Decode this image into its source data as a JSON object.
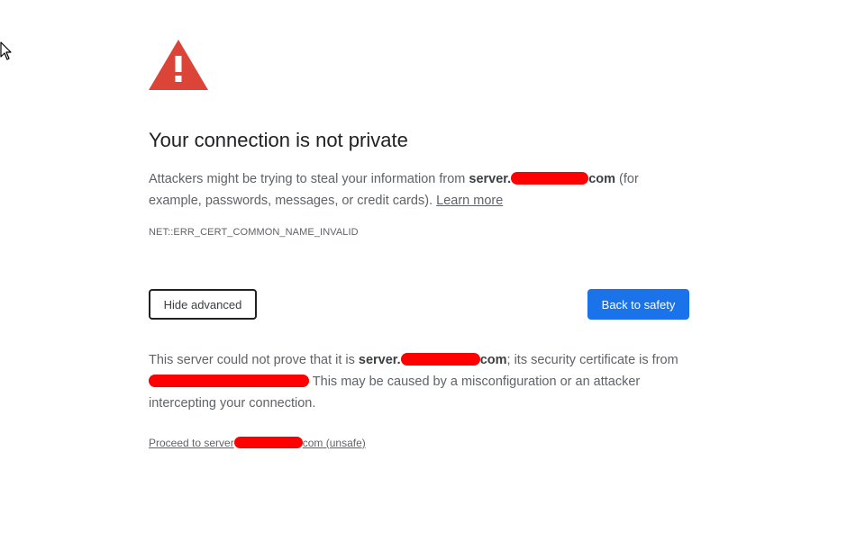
{
  "interstitial": {
    "title": "Your connection is not private",
    "intro": {
      "text_before": "Attackers might be trying to steal your information from ",
      "domain_prefix": "server.",
      "domain_suffix": "com",
      "text_after": " (for example, passwords, messages, or credit cards). ",
      "learn_more": "Learn more"
    },
    "error_code": "NET::ERR_CERT_COMMON_NAME_INVALID",
    "hide_advanced_label": "Hide advanced",
    "back_to_safety_label": "Back to safety",
    "detail": {
      "text_before": "This server could not prove that it is ",
      "domain_prefix": "server.",
      "domain_suffix": "com",
      "text_mid": "; its security certificate is from ",
      "text_after": " This may be caused by a misconfiguration or an attacker intercepting your connection."
    },
    "proceed": {
      "prefix": "Proceed to server",
      "suffix": "com (unsafe)"
    }
  },
  "colors": {
    "warning_red": "#db4437",
    "primary_blue": "#1a73e8",
    "redaction": "#ff0000"
  },
  "icons": {
    "warning": "warning-triangle-icon",
    "cursor": "mouse-cursor-icon"
  }
}
